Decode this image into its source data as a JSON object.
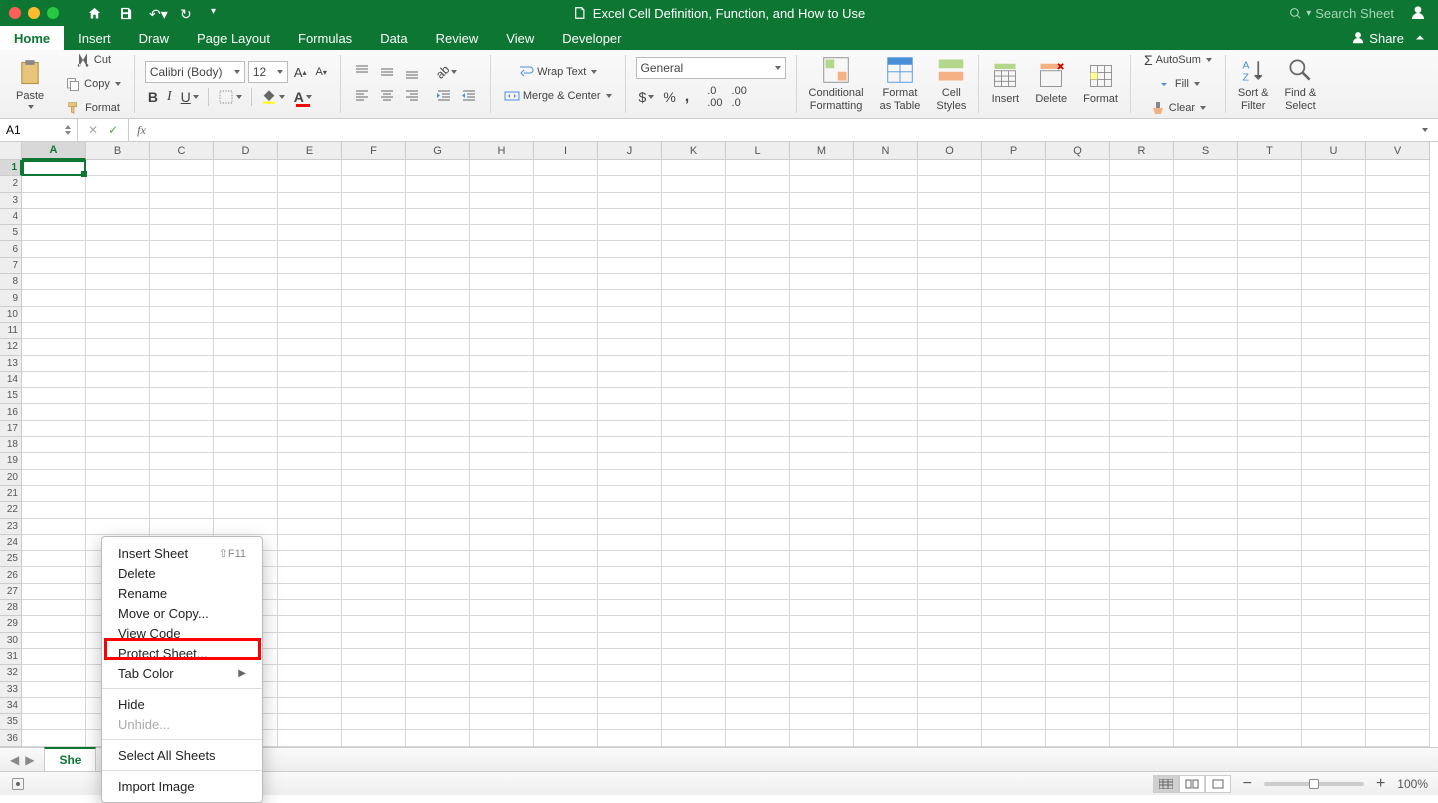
{
  "titlebar": {
    "doc_title": "Excel Cell Definition, Function, and How to Use",
    "search_placeholder": "Search Sheet"
  },
  "tabs": {
    "items": [
      "Home",
      "Insert",
      "Draw",
      "Page Layout",
      "Formulas",
      "Data",
      "Review",
      "View",
      "Developer"
    ],
    "active_index": 0,
    "share": "Share"
  },
  "ribbon": {
    "paste": "Paste",
    "cut": "Cut",
    "copy": "Copy",
    "format_painter": "Format",
    "font_name": "Calibri (Body)",
    "font_size": "12",
    "wrap_text": "Wrap Text",
    "merge_center": "Merge & Center",
    "number_format": "General",
    "cond_fmt": "Conditional\nFormatting",
    "fmt_table": "Format\nas Table",
    "cell_styles": "Cell\nStyles",
    "insert": "Insert",
    "delete": "Delete",
    "format": "Format",
    "autosum": "AutoSum",
    "fill": "Fill",
    "clear": "Clear",
    "sort_filter": "Sort &\nFilter",
    "find_select": "Find &\nSelect"
  },
  "formula_bar": {
    "name_box": "A1",
    "formula": ""
  },
  "grid": {
    "columns": [
      "A",
      "B",
      "C",
      "D",
      "E",
      "F",
      "G",
      "H",
      "I",
      "J",
      "K",
      "L",
      "M",
      "N",
      "O",
      "P",
      "Q",
      "R",
      "S",
      "T",
      "U",
      "V"
    ],
    "row_count": 36,
    "selected_col_index": 0,
    "selected_row_index": 0,
    "selected_cell": "A1"
  },
  "sheet_tabs": {
    "active_prefix": "She"
  },
  "status": {
    "zoom": "100%"
  },
  "context_menu": {
    "items": [
      {
        "label": "Insert Sheet",
        "shortcut": "⇧F11"
      },
      {
        "label": "Delete"
      },
      {
        "label": "Rename"
      },
      {
        "label": "Move or Copy..."
      },
      {
        "label": "View Code"
      },
      {
        "label": "Protect Sheet...",
        "highlighted": true
      },
      {
        "label": "Tab Color",
        "submenu": true
      },
      {
        "sep": true
      },
      {
        "label": "Hide"
      },
      {
        "label": "Unhide...",
        "disabled": true
      },
      {
        "sep": true
      },
      {
        "label": "Select All Sheets"
      },
      {
        "sep": true
      },
      {
        "label": "Import Image"
      }
    ]
  }
}
